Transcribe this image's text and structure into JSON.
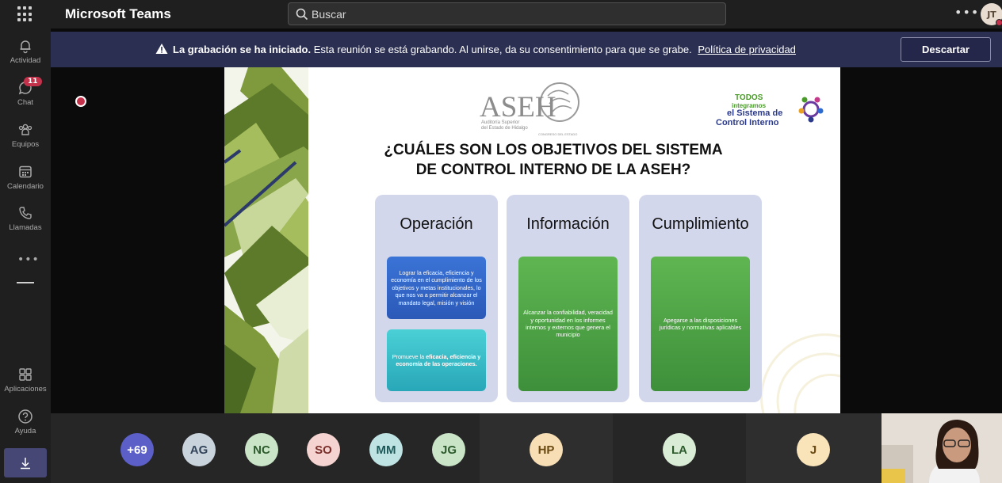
{
  "app": {
    "title": "Microsoft Teams",
    "me_initials": "JT"
  },
  "search": {
    "placeholder": "Buscar"
  },
  "rail": {
    "items": [
      {
        "label": "Actividad",
        "icon": "bell-icon"
      },
      {
        "label": "Chat",
        "icon": "chat-icon",
        "badge": "11"
      },
      {
        "label": "Equipos",
        "icon": "teams-icon"
      },
      {
        "label": "Calendario",
        "icon": "calendar-icon"
      },
      {
        "label": "Llamadas",
        "icon": "phone-icon"
      },
      {
        "label": "Aplicaciones",
        "icon": "apps-icon"
      },
      {
        "label": "Ayuda",
        "icon": "help-icon"
      }
    ]
  },
  "banner": {
    "bold": "La grabación se ha iniciado.",
    "text": "Esta reunión se está grabando. Al unirse, da su consentimiento para que se grabe.",
    "link": "Política de privacidad",
    "dismiss": "Descartar"
  },
  "slide": {
    "logo_text": "ASEH",
    "logo_sub1": "Auditoría Superior",
    "logo_sub2": "del Estado de Hidalgo",
    "logo_sub3": "CONGRESO DEL ESTADO",
    "todos_1": "TODOS",
    "todos_2": "integramos",
    "todos_3": "el Sistema de",
    "todos_4": "Control Interno",
    "title_line1": "¿CUÁLES SON LOS OBJETIVOS DEL SISTEMA",
    "title_line2": "DE CONTROL INTERNO DE LA ASEH?",
    "columns": [
      {
        "title": "Operación",
        "card1": "Lograr la eficacia, eficiencia y economía en el cumplimiento de los objetivos y metas institucionales, lo que nos va a permitir alcanzar el mandato legal, misión y visión",
        "card2_pre": "Promueve la ",
        "card2_bold": "eficacia, eficiencia y economía de las operaciones."
      },
      {
        "title": "Información",
        "card1": "Alcanzar la confiabilidad, veracidad y oportunidad en los informes internos y externos que genera el municipio"
      },
      {
        "title": "Cumplimiento",
        "card1": "Apegarse a las disposiciones jurídicas y normativas aplicables"
      }
    ]
  },
  "participants": [
    {
      "initials": "+69",
      "bg": "#5b5fc7",
      "fg": "#ffffff"
    },
    {
      "initials": "AG",
      "bg": "#c9d3dc",
      "fg": "#33445a"
    },
    {
      "initials": "NC",
      "bg": "#c9e4c7",
      "fg": "#2c5a2c"
    },
    {
      "initials": "SO",
      "bg": "#f5d3d0",
      "fg": "#7a2e2a"
    },
    {
      "initials": "MM",
      "bg": "#bfe3e3",
      "fg": "#1f5a5a"
    },
    {
      "initials": "JG",
      "bg": "#c9e4c7",
      "fg": "#2c5a2c"
    },
    {
      "initials": "HP",
      "bg": "#f7deb5",
      "fg": "#6a4a12"
    },
    {
      "initials": "LA",
      "bg": "#d9ecd5",
      "fg": "#2c5a2c"
    },
    {
      "initials": "J",
      "bg": "#f9e3b9",
      "fg": "#6a4a12"
    }
  ],
  "colors": {
    "rail": "#1f1f1f",
    "banner": "#2b2f52",
    "accent": "#5b5fc7"
  }
}
